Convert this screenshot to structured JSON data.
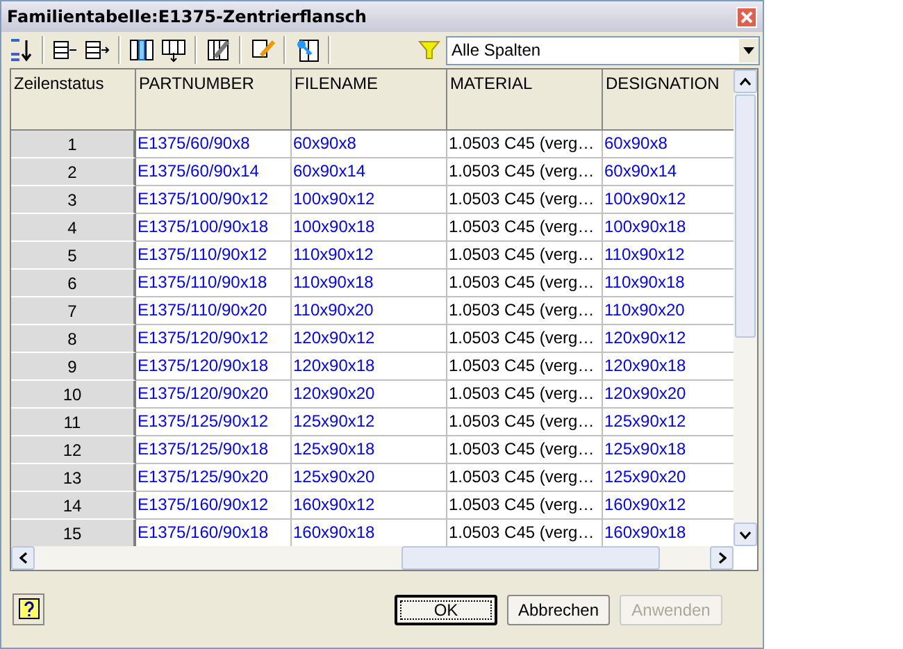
{
  "window": {
    "title": "Familientabelle:E1375-Zentrierflansch"
  },
  "filter": {
    "value": "Alle Spalten"
  },
  "table": {
    "row_header": "Zeilenstatus",
    "columns": [
      {
        "label": "PARTNUMBER",
        "color": "#0000ff"
      },
      {
        "label": "FILENAME",
        "color": "#0000ff"
      },
      {
        "label": "MATERIAL",
        "color": "#000000"
      },
      {
        "label": "DESIGNATION",
        "color": "#0000ff"
      }
    ],
    "rows": [
      {
        "status": "1",
        "cells": [
          "E1375/60/90x8",
          "60x90x8",
          "1.0503 C45 (verg…",
          "60x90x8"
        ]
      },
      {
        "status": "2",
        "cells": [
          "E1375/60/90x14",
          "60x90x14",
          "1.0503 C45 (verg…",
          "60x90x14"
        ]
      },
      {
        "status": "3",
        "cells": [
          "E1375/100/90x12",
          "100x90x12",
          "1.0503 C45 (verg…",
          "100x90x12"
        ]
      },
      {
        "status": "4",
        "cells": [
          "E1375/100/90x18",
          "100x90x18",
          "1.0503 C45 (verg…",
          "100x90x18"
        ]
      },
      {
        "status": "5",
        "cells": [
          "E1375/110/90x12",
          "110x90x12",
          "1.0503 C45 (verg…",
          "110x90x12"
        ]
      },
      {
        "status": "6",
        "cells": [
          "E1375/110/90x18",
          "110x90x18",
          "1.0503 C45 (verg…",
          "110x90x18"
        ]
      },
      {
        "status": "7",
        "cells": [
          "E1375/110/90x20",
          "110x90x20",
          "1.0503 C45 (verg…",
          "110x90x20"
        ]
      },
      {
        "status": "8",
        "cells": [
          "E1375/120/90x12",
          "120x90x12",
          "1.0503 C45 (verg…",
          "120x90x12"
        ]
      },
      {
        "status": "9",
        "cells": [
          "E1375/120/90x18",
          "120x90x18",
          "1.0503 C45 (verg…",
          "120x90x18"
        ]
      },
      {
        "status": "10",
        "cells": [
          "E1375/120/90x20",
          "120x90x20",
          "1.0503 C45 (verg…",
          "120x90x20"
        ]
      },
      {
        "status": "11",
        "cells": [
          "E1375/125/90x12",
          "125x90x12",
          "1.0503 C45 (verg…",
          "125x90x12"
        ]
      },
      {
        "status": "12",
        "cells": [
          "E1375/125/90x18",
          "125x90x18",
          "1.0503 C45 (verg…",
          "125x90x18"
        ]
      },
      {
        "status": "13",
        "cells": [
          "E1375/125/90x20",
          "125x90x20",
          "1.0503 C45 (verg…",
          "125x90x20"
        ]
      },
      {
        "status": "14",
        "cells": [
          "E1375/160/90x12",
          "160x90x12",
          "1.0503 C45 (verg…",
          "160x90x12"
        ]
      },
      {
        "status": "15",
        "cells": [
          "E1375/160/90x18",
          "160x90x18",
          "1.0503 C45 (verg…",
          "160x90x18"
        ]
      }
    ]
  },
  "buttons": [
    {
      "label": "OK",
      "default": true,
      "disabled": false
    },
    {
      "label": "Abbrechen",
      "default": false,
      "disabled": false
    },
    {
      "label": "Anwenden",
      "default": false,
      "disabled": true
    }
  ]
}
